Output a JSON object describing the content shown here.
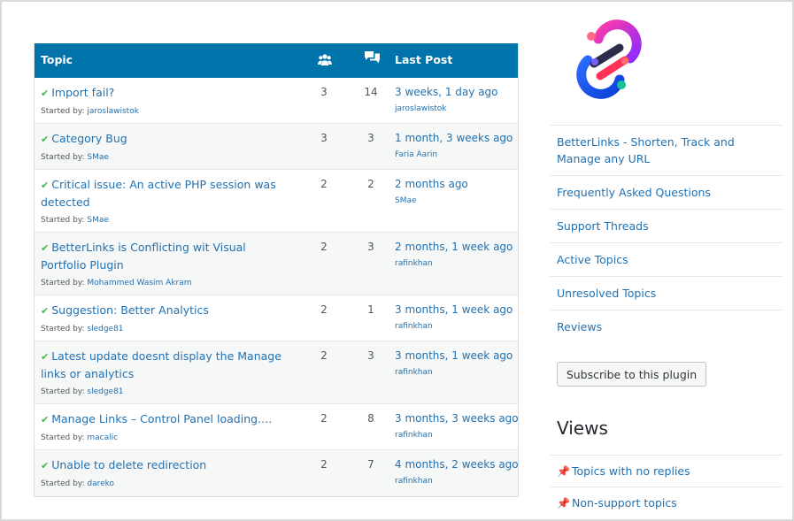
{
  "table": {
    "header": {
      "topic": "Topic",
      "voices_icon": "users-icon",
      "posts_icon": "speech-bubbles-icon",
      "last_post": "Last Post"
    },
    "started_by_label": "Started by:",
    "rows": [
      {
        "title": "Import fail?",
        "author": "jaroslawistok",
        "voices": "3",
        "posts": "14",
        "last_time": "3 weeks, 1 day ago",
        "last_author": "jaroslawistok"
      },
      {
        "title": "Category Bug",
        "author": "SMae",
        "voices": "3",
        "posts": "3",
        "last_time": "1 month, 3 weeks ago",
        "last_author": "Faria Aarin"
      },
      {
        "title": "Critical issue: An active PHP session was detected",
        "author": "SMae",
        "voices": "2",
        "posts": "2",
        "last_time": "2 months ago",
        "last_author": "SMae"
      },
      {
        "title": "BetterLinks is Conflicting wit Visual Portfolio Plugin",
        "author": "Mohammed Wasim Akram",
        "voices": "2",
        "posts": "3",
        "last_time": "2 months, 1 week ago",
        "last_author": "rafinkhan"
      },
      {
        "title": "Suggestion: Better Analytics",
        "author": "sledge81",
        "voices": "2",
        "posts": "1",
        "last_time": "3 months, 1 week ago",
        "last_author": "rafinkhan"
      },
      {
        "title": "Latest update doesnt display the Manage links or analytics",
        "author": "sledge81",
        "voices": "2",
        "posts": "3",
        "last_time": "3 months, 1 week ago",
        "last_author": "rafinkhan"
      },
      {
        "title": "Manage Links – Control Panel loading.…",
        "author": "macalic",
        "voices": "2",
        "posts": "8",
        "last_time": "3 months, 3 weeks ago",
        "last_author": "rafinkhan"
      },
      {
        "title": "Unable to delete redirection",
        "author": "dareko",
        "voices": "2",
        "posts": "7",
        "last_time": "4 months, 2 weeks ago",
        "last_author": "rafinkhan"
      }
    ]
  },
  "sidebar": {
    "logo_icon": "betterlinks-logo-icon",
    "links": [
      "BetterLinks - Shorten, Track and Manage any URL",
      "Frequently Asked Questions",
      "Support Threads",
      "Active Topics",
      "Unresolved Topics",
      "Reviews"
    ],
    "subscribe_label": "Subscribe to this plugin",
    "views_title": "Views",
    "views": [
      {
        "icon": "pin-icon",
        "label": "Topics with no replies"
      },
      {
        "icon": "pin-icon",
        "label": "Non-support topics"
      }
    ]
  },
  "colors": {
    "header_bg": "#0073aa",
    "link": "#2271b1",
    "resolved_check": "#46b450"
  }
}
